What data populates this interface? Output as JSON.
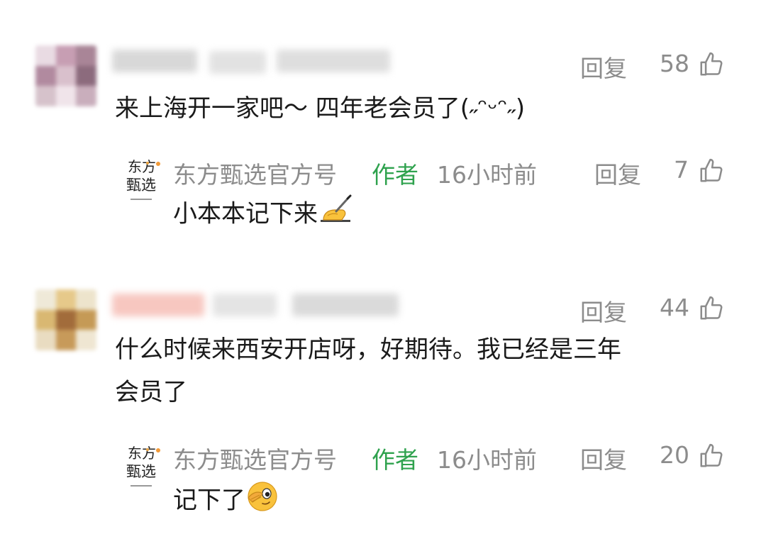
{
  "comments": [
    {
      "text": "来上海开一家吧～ 四年老会员了(˶ᵔᵕᵔ˶)",
      "reply_label": "回复",
      "likes": "58",
      "reply": {
        "name": "东方甄选官方号",
        "author_badge": "作者",
        "time": "16小时前",
        "reply_label": "回复",
        "likes": "7",
        "text": "小本本记下来"
      }
    },
    {
      "text_line1": "什么时候来西安开店呀，好期待。我已经是三年",
      "text_line2": "会员了",
      "reply_label": "回复",
      "likes": "44",
      "reply": {
        "name": "东方甄选官方号",
        "author_badge": "作者",
        "time": "16小时前",
        "reply_label": "回复",
        "likes": "20",
        "text": "记下了"
      }
    }
  ],
  "logo": {
    "line1": "东方",
    "line2": "甄选"
  },
  "icons": {
    "thumb": "thumbs-up-icon",
    "writing": "writing-hand-emoji",
    "facepalm": "peek-face-emoji"
  },
  "colors": {
    "author_green": "#2fa24e",
    "meta_gray": "#8c8c8c"
  }
}
